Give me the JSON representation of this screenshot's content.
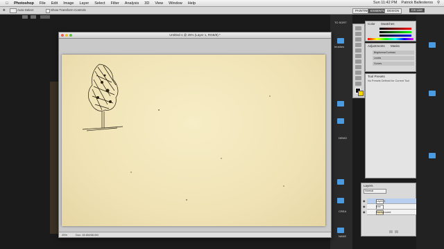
{
  "menubar": {
    "apple": "",
    "app_name": "Photoshop",
    "items": [
      "File",
      "Edit",
      "Image",
      "Layer",
      "Select",
      "Filter",
      "Analysis",
      "3D",
      "View",
      "Window",
      "Help"
    ],
    "time": "Sun 11:42 PM",
    "user": "Patrick Ballesteros"
  },
  "options_bar": {
    "zoom_options": "Auto-Select",
    "transform": "Show Transform Controls",
    "workspaces": [
      "PAINTING",
      "ESSENTIALS",
      "DESIGN",
      "CS Live"
    ],
    "active_workspace": "ESSENTIALS"
  },
  "document": {
    "title": "Untitled-1 @ 25% (Layer 1, RGB/8) *",
    "status_zoom": "25%",
    "status_doc": "Doc: 45.6M/68.0M"
  },
  "color_panel": {
    "tabs": [
      "Color",
      "Swatches"
    ]
  },
  "adjust_panel": {
    "tabs": [
      "Adjustments",
      "Masks"
    ],
    "items": [
      "Brightness/Contrast",
      "Levels",
      "Curves"
    ]
  },
  "preset_panel": {
    "tabs": [
      "Tool Presets"
    ],
    "message": "No Presets Defined for Current Tool"
  },
  "layers_panel": {
    "tabs": [
      "Layers"
    ],
    "blend_mode": "Normal",
    "layers": [
      "Layer 1",
      "tree",
      "Background"
    ],
    "selected_index": 0
  },
  "desktop": {
    "labels": [
      "TO SORT",
      "brushes",
      "DEMO",
      "CREA",
      "NANE"
    ]
  },
  "colors": {
    "canvas": "#f2e6ba",
    "workspace": "#1b1b1b",
    "folder": "#4a9be0",
    "selection": "#b8cff0"
  }
}
